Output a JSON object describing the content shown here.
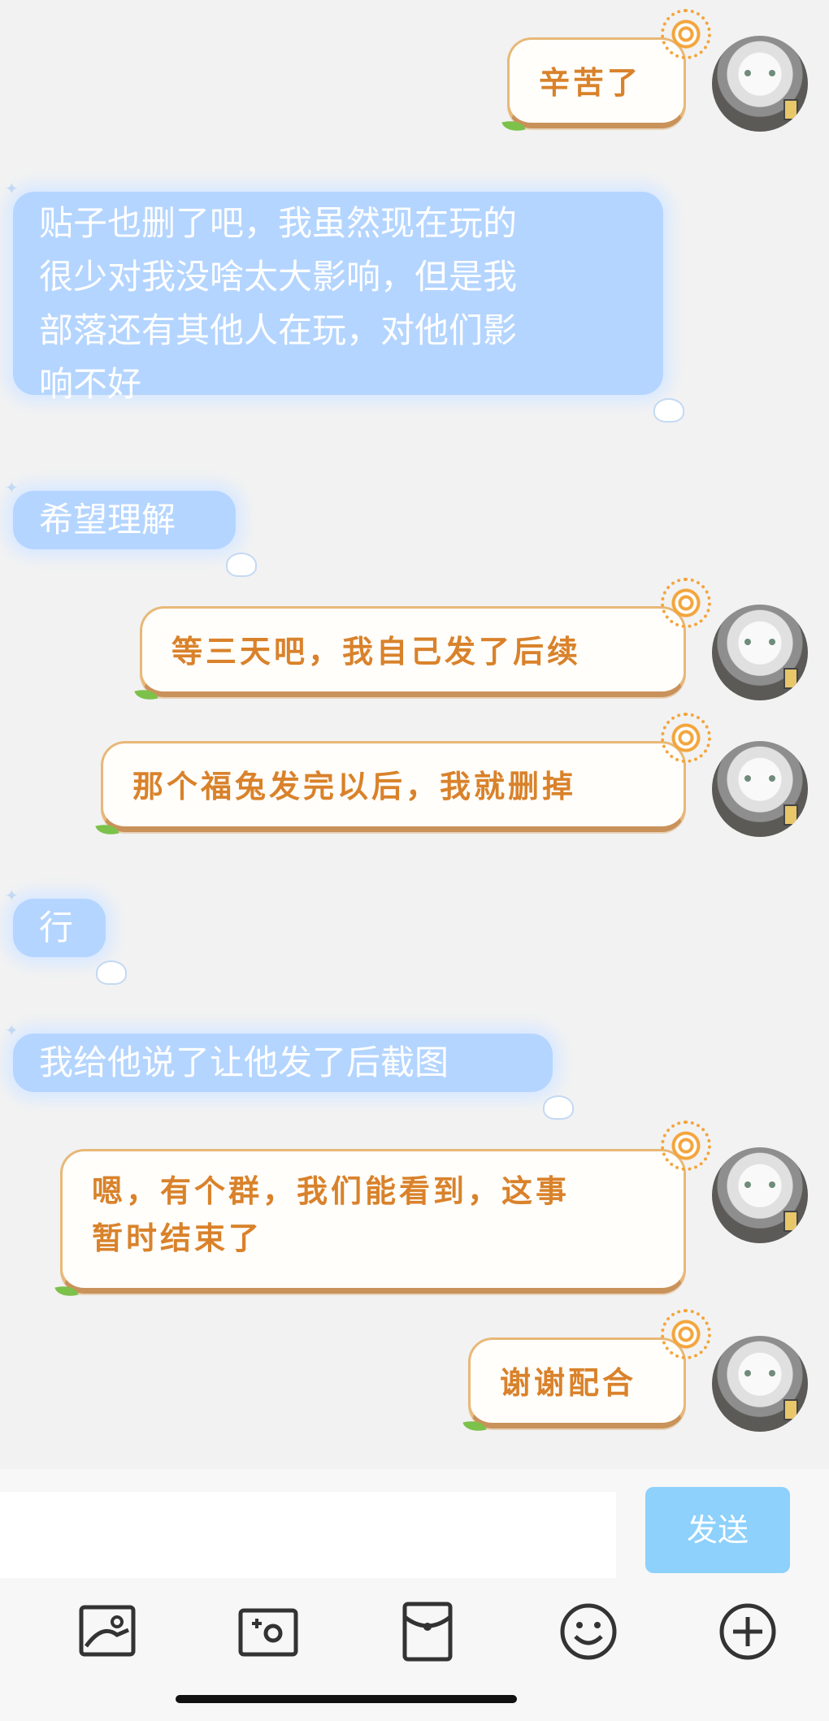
{
  "messages": [
    {
      "side": "out",
      "lines": [
        "辛苦了"
      ]
    },
    {
      "side": "in",
      "lines": [
        "贴子也删了吧，我虽然现在玩的",
        "很少对我没啥太大影响，但是我",
        "部落还有其他人在玩，对他们影",
        "响不好"
      ]
    },
    {
      "side": "in",
      "lines": [
        "希望理解"
      ]
    },
    {
      "side": "out",
      "lines": [
        "等三天吧，我自己发了后续"
      ]
    },
    {
      "side": "out",
      "lines": [
        "那个福兔发完以后，我就删掉"
      ]
    },
    {
      "side": "in",
      "lines": [
        "行"
      ]
    },
    {
      "side": "in",
      "lines": [
        "我给他说了让他发了后截图"
      ]
    },
    {
      "side": "out",
      "lines": [
        "嗯，有个群，我们能看到，这事",
        "暂时结束了"
      ]
    },
    {
      "side": "out",
      "lines": [
        "谢谢配合"
      ]
    }
  ],
  "composer": {
    "input_value": "",
    "send_label": "发送"
  },
  "toolbar": {
    "icons": [
      "image-icon",
      "camera-icon",
      "red-packet-icon",
      "emoji-icon",
      "plus-icon"
    ]
  },
  "colors": {
    "background": "#f2f2f2",
    "out_text": "#d9822b",
    "out_border": "#e8b878",
    "in_bubble": "#b4d5ff",
    "send_button": "#8dd1fc"
  }
}
